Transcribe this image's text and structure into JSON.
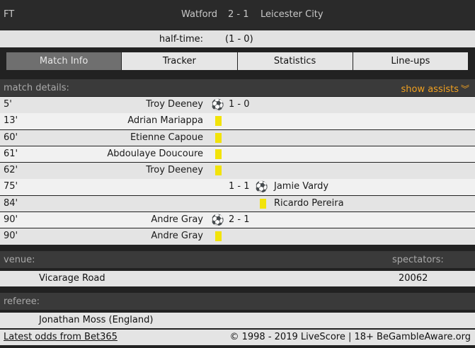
{
  "header": {
    "status": "FT",
    "home_team": "Watford",
    "score": "2 - 1",
    "away_team": "Leicester City"
  },
  "halftime": {
    "label": "half-time:",
    "score": "(1 - 0)"
  },
  "tabs": [
    {
      "label": "Match Info",
      "active": true
    },
    {
      "label": "Tracker",
      "active": false
    },
    {
      "label": "Statistics",
      "active": false
    },
    {
      "label": "Line-ups",
      "active": false
    }
  ],
  "match_details": {
    "title": "match details:",
    "show_assists": "show assists",
    "chevron_icon": "double-chevron-down-icon"
  },
  "events": [
    {
      "minute": "5'",
      "side": "home",
      "type": "goal",
      "player": "Troy Deeney",
      "score": "1 - 0"
    },
    {
      "minute": "13'",
      "side": "home",
      "type": "yellow-card",
      "player": "Adrian Mariappa",
      "score": ""
    },
    {
      "minute": "60'",
      "side": "home",
      "type": "yellow-card",
      "player": "Etienne Capoue",
      "score": ""
    },
    {
      "minute": "61'",
      "side": "home",
      "type": "yellow-card",
      "player": "Abdoulaye Doucoure",
      "score": ""
    },
    {
      "minute": "62'",
      "side": "home",
      "type": "yellow-card",
      "player": "Troy Deeney",
      "score": ""
    },
    {
      "minute": "75'",
      "side": "away",
      "type": "goal",
      "player": "Jamie Vardy",
      "score": "1 - 1"
    },
    {
      "minute": "84'",
      "side": "away",
      "type": "yellow-card",
      "player": "Ricardo Pereira",
      "score": ""
    },
    {
      "minute": "90'",
      "side": "home",
      "type": "goal",
      "player": "Andre Gray",
      "score": "2 - 1"
    },
    {
      "minute": "90'",
      "side": "home",
      "type": "yellow-card",
      "player": "Andre Gray",
      "score": ""
    }
  ],
  "venue": {
    "label": "venue:",
    "name": "Vicarage Road",
    "spectators_label": "spectators:",
    "spectators": "20062"
  },
  "referee": {
    "label": "referee:",
    "name": "Jonathan Moss (England)"
  },
  "footer": {
    "odds_link": "Latest odds from Bet365",
    "copyright": "© 1998 - 2019 LiveScore | 18+ BeGambleAware.org"
  },
  "colors": {
    "accent": "#f0a020",
    "yellow_card": "#f2e30a",
    "active_tab": "#6f6f6f"
  }
}
